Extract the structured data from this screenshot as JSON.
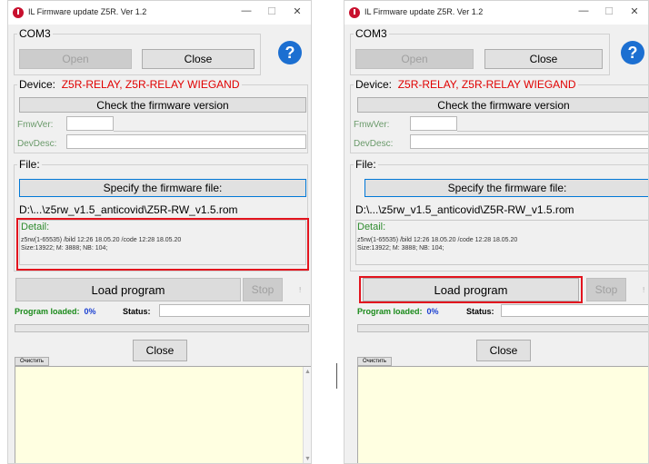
{
  "window": {
    "title": "IL Firmware update Z5R. Ver 1.2",
    "minimize_glyph": "—",
    "maximize_glyph": "☐",
    "close_glyph": "✕"
  },
  "com": {
    "label": "COM3",
    "open_label": "Open",
    "close_label": "Close",
    "help_glyph": "?"
  },
  "device": {
    "label": "Device:",
    "models": "Z5R-RELAY, Z5R-RELAY WIEGAND",
    "check_label": "Check the firmware version",
    "fmwver_label": "FmwVer:",
    "devdesc_label": "DevDesc:"
  },
  "file": {
    "label": "File:",
    "specify_label": "Specify the firmware file:",
    "path": "D:\\...\\z5rw_v1.5_anticovid\\Z5R-RW_v1.5.rom",
    "detail_label": "Detail:",
    "detail_line1": "z5rw(1-65535) /bild 12:26 18.05.20 /code 12:28 18.05.20",
    "detail_line2": "Size:13922; M: 3888; NB: 104;"
  },
  "program": {
    "load_label": "Load program",
    "stop_label": "Stop",
    "mark": "!",
    "loaded_label": "Program loaded:",
    "percent": "0%",
    "status_label": "Status:",
    "progress_fraction": 0
  },
  "bottom": {
    "close_label": "Close",
    "clear_label": "Очистить"
  },
  "highlight_color": "#e3141e"
}
